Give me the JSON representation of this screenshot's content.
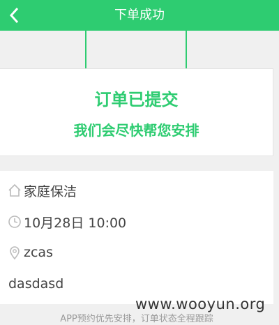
{
  "header": {
    "title": "下单成功",
    "back_icon": "chevron-left-icon"
  },
  "card": {
    "line1": "订单已提交",
    "line2": "我们会尽快帮您安排"
  },
  "info": {
    "service": "家庭保洁",
    "time": "10月28日 10:00",
    "address": "zcas",
    "note": "dasdasd"
  },
  "footer": {
    "text": "APP预约优先安排，订单状态全程跟踪"
  },
  "watermark": "www.wooyun.org",
  "colors": {
    "accent": "#2ecc71"
  }
}
